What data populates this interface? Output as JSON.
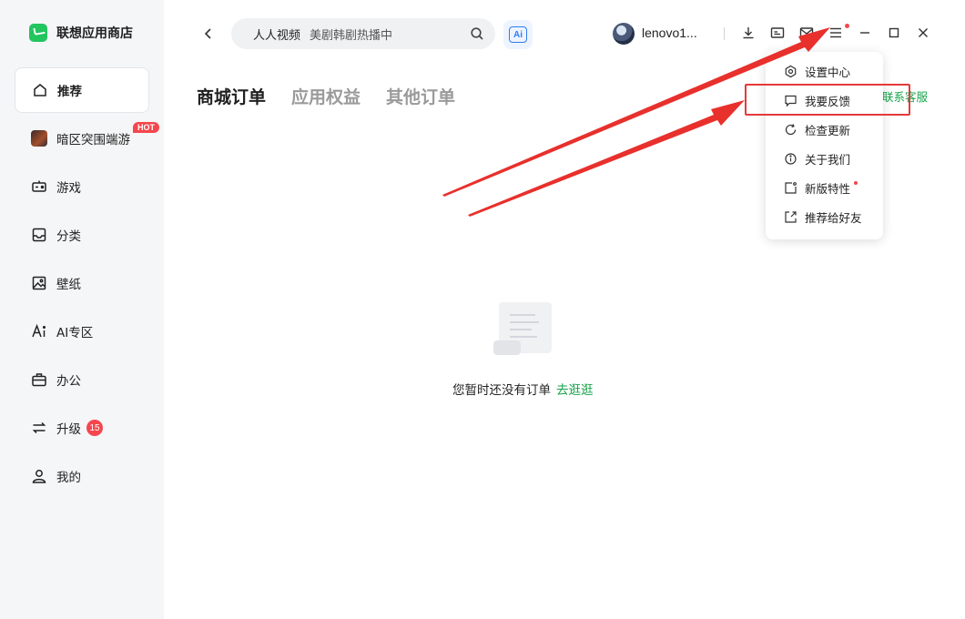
{
  "brand": {
    "name": "联想应用商店"
  },
  "sidebar": {
    "items": [
      {
        "label": "推荐"
      },
      {
        "label": "暗区突围端游",
        "badge": "HOT"
      },
      {
        "label": "游戏"
      },
      {
        "label": "分类"
      },
      {
        "label": "壁纸"
      },
      {
        "label": "AI专区"
      },
      {
        "label": "办公"
      },
      {
        "label": "升级",
        "badge": "15"
      },
      {
        "label": "我的"
      }
    ]
  },
  "header": {
    "search_hint_primary": "人人视频",
    "search_hint_secondary": "美剧韩剧热播中",
    "ai_label": "Ai",
    "username": "lenovo1..."
  },
  "tabs": [
    {
      "label": "商城订单"
    },
    {
      "label": "应用权益"
    },
    {
      "label": "其他订单"
    }
  ],
  "contact_link": "联系客服",
  "empty_state": {
    "message": "您暂时还没有订单",
    "link": "去逛逛"
  },
  "dropdown": {
    "items": [
      {
        "label": "设置中心"
      },
      {
        "label": "我要反馈"
      },
      {
        "label": "检查更新"
      },
      {
        "label": "关于我们"
      },
      {
        "label": "新版特性"
      },
      {
        "label": "推荐给好友"
      }
    ]
  },
  "colors": {
    "accent": "#16a34a",
    "badge": "#f5464e",
    "annotation": "#e5393a"
  }
}
